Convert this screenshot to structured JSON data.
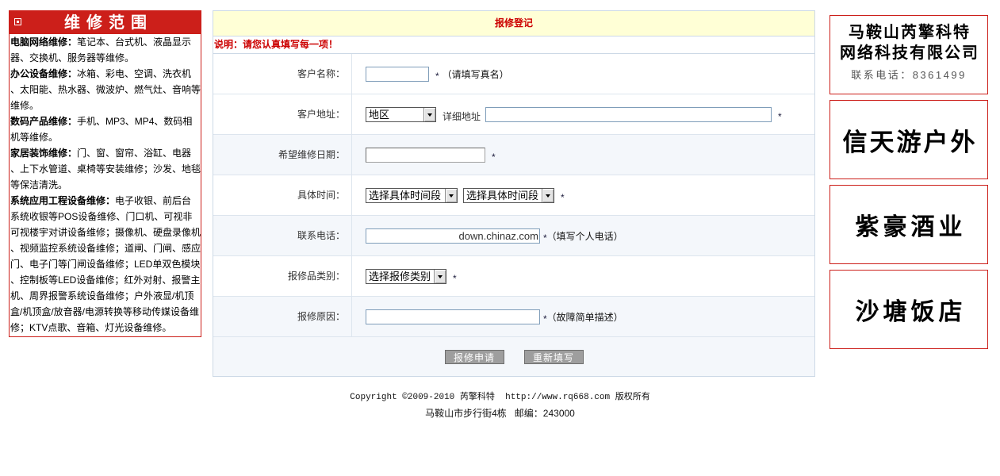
{
  "sidebar": {
    "title": "维修范围",
    "sections": [
      {
        "heading": "电脑网络维修：",
        "text": "笔记本、台式机、液晶显示器、交换机、服务器等维修。"
      },
      {
        "heading": "办公设备维修：",
        "text": "冰箱、彩电、空调、洗衣机、太阳能、热水器、微波炉、燃气灶、音响等维修。"
      },
      {
        "heading": "数码产品维修：",
        "text": "手机、MP3、MP4、数码相机等维修。"
      },
      {
        "heading": "家居装饰维修：",
        "text": "门、窗、窗帘、浴缸、电器、上下水管道、桌椅等安装维修；沙发、地毯等保洁清洗。"
      },
      {
        "heading": "系统应用工程设备维修：",
        "text": "电子收银、前后台系统收银等POS设备维修、门口机、可视非可视楼宇对讲设备维修；摄像机、硬盘录像机、视频监控系统设备维修；道闸、门闸、感应门、电子门等门闸设备维修；LED单双色模块、控制板等LED设备维修；红外对射、报警主机、周界报警系统设备维修；户外液显/机顶盒/机顶盒/放音器/电源转换等移动传媒设备维修；KTV点歌、音箱、灯光设备维修。"
      }
    ]
  },
  "form": {
    "title": "报修登记",
    "notice": "说明：请您认真填写每一项！",
    "required_mark": "*",
    "name": {
      "label": "客户名称：",
      "hint": "（请填写真名）"
    },
    "address": {
      "label": "客户地址：",
      "region_selected": "地区",
      "detail_label": "详细地址"
    },
    "date": {
      "label": "希望维修日期："
    },
    "time": {
      "label": "具体时间：",
      "start_selected": "选择具体时间段",
      "end_selected": "选择具体时间段"
    },
    "phone": {
      "label": "联系电话：",
      "hint": "（填写个人电话）"
    },
    "category": {
      "label": "报修品类别：",
      "selected": "选择报修类别"
    },
    "reason": {
      "label": "报修原因：",
      "hint": "（故障简单描述）"
    },
    "buttons": {
      "submit": "报修申请",
      "reset": "重新填写"
    }
  },
  "watermark": {
    "text": "down.chinaz.com"
  },
  "footer": {
    "copyright": "Copyright ©2009-2010 芮擎科特  http://www.rq668.com 版权所有",
    "address": "马鞍山市步行街4栋   邮编：243000"
  },
  "ads": [
    {
      "line1": "马鞍山芮擎科特",
      "line2": "网络科技有限公司",
      "phone": "联系电话：8361499"
    },
    {
      "name": "信天游户外"
    },
    {
      "name": "紫豪酒业"
    },
    {
      "name": "沙塘饭店"
    }
  ],
  "colors": {
    "accent_red": "#cc1f1a",
    "header_yellow": "#ffffd6",
    "table_border": "#cdd9e6",
    "row_shade": "#f4f7fb"
  }
}
